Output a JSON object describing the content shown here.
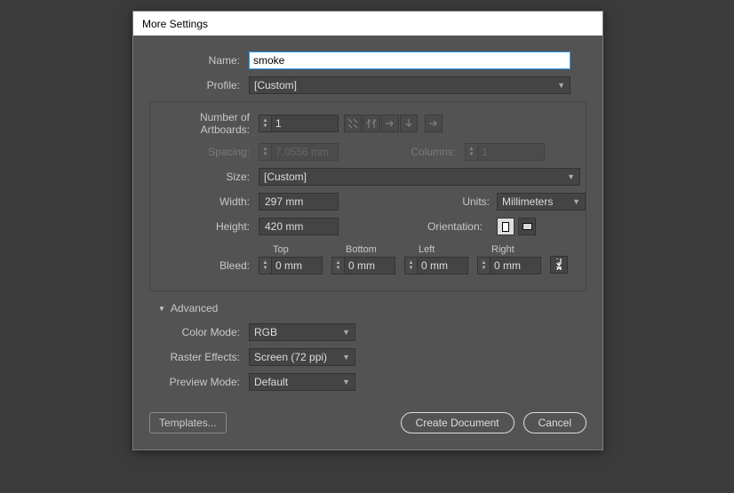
{
  "dialog": {
    "title": "More Settings"
  },
  "form": {
    "name_label": "Name:",
    "name_value": "smoke",
    "profile_label": "Profile:",
    "profile_value": "[Custom]",
    "artboards_label": "Number of Artboards:",
    "artboards_value": "1",
    "spacing_label": "Spacing:",
    "spacing_value": "7.0556 mm",
    "columns_label": "Columns:",
    "columns_value": "1",
    "size_label": "Size:",
    "size_value": "[Custom]",
    "width_label": "Width:",
    "width_value": "297 mm",
    "units_label": "Units:",
    "units_value": "Millimeters",
    "height_label": "Height:",
    "height_value": "420 mm",
    "orientation_label": "Orientation:",
    "bleed_label": "Bleed:",
    "bleed": {
      "top_label": "Top",
      "top_value": "0 mm",
      "bottom_label": "Bottom",
      "bottom_value": "0 mm",
      "left_label": "Left",
      "left_value": "0 mm",
      "right_label": "Right",
      "right_value": "0 mm"
    }
  },
  "advanced": {
    "header": "Advanced",
    "color_mode_label": "Color Mode:",
    "color_mode_value": "RGB",
    "raster_label": "Raster Effects:",
    "raster_value": "Screen (72 ppi)",
    "preview_label": "Preview Mode:",
    "preview_value": "Default"
  },
  "footer": {
    "templates": "Templates...",
    "create": "Create Document",
    "cancel": "Cancel"
  }
}
